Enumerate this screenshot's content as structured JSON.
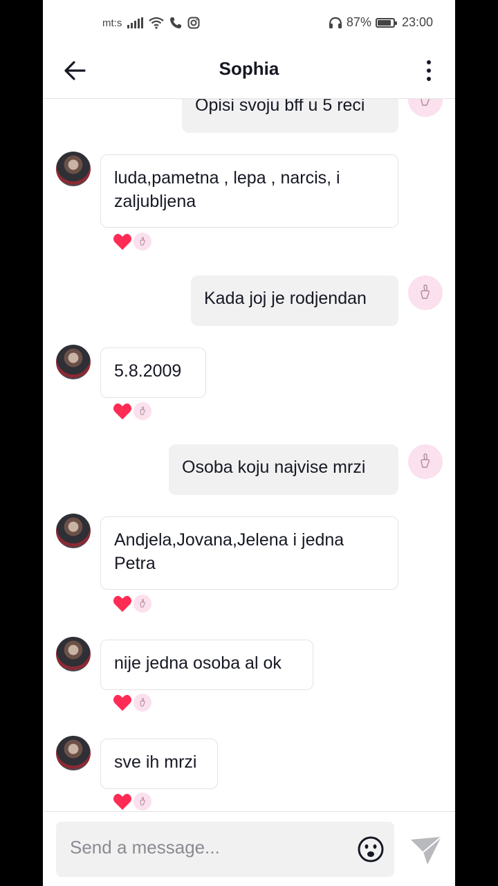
{
  "status_bar": {
    "carrier": "mt:s",
    "battery_percent": "87%",
    "battery_level": 0.87,
    "time": "23:00"
  },
  "header": {
    "title": "Sophia"
  },
  "messages": [
    {
      "from": "me",
      "text": "Opisi svoju bff u 5 reci"
    },
    {
      "from": "them",
      "text": "luda,pametna , lepa , narcis, i zaljubljena",
      "reactions": [
        "heart",
        "sticker"
      ]
    },
    {
      "from": "me",
      "text": "Kada joj je rodjendan"
    },
    {
      "from": "them",
      "text": "5.8.2009",
      "reactions": [
        "heart",
        "sticker"
      ]
    },
    {
      "from": "me",
      "text": "Osoba koju najvise mrzi"
    },
    {
      "from": "them",
      "text": "Andjela,Jovana,Jelena i jedna Petra",
      "reactions": [
        "heart",
        "sticker"
      ]
    },
    {
      "from": "them",
      "text": "nije jedna osoba al ok",
      "reactions": [
        "heart",
        "sticker"
      ]
    },
    {
      "from": "them",
      "text": "sve ih mrzi",
      "reactions": [
        "heart",
        "sticker"
      ]
    }
  ],
  "composer": {
    "placeholder": "Send a message..."
  },
  "colors": {
    "heart": "#fe2c55",
    "own_bubble": "#f1f1f2",
    "avatar_badge": "#fbe0ee"
  },
  "icons": [
    "back-arrow-icon",
    "more-dots-icon",
    "emoji-icon",
    "send-icon",
    "wifi-icon",
    "phone-icon",
    "instagram-icon",
    "headphones-icon"
  ]
}
